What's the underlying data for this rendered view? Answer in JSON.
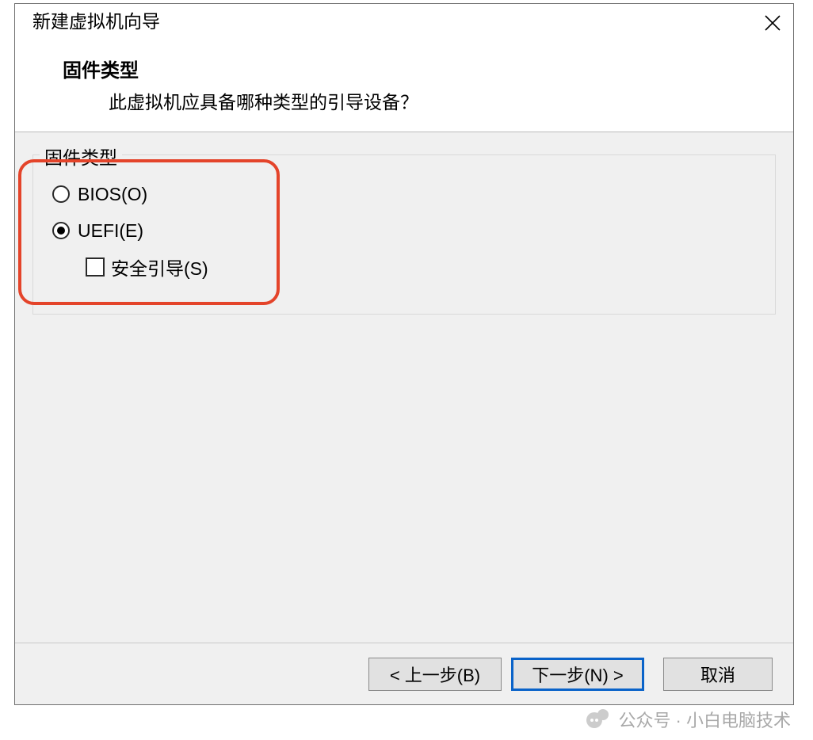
{
  "dialog": {
    "title": "新建虚拟机向导",
    "close_icon": "close"
  },
  "header": {
    "title": "固件类型",
    "subtitle": "此虚拟机应具备哪种类型的引导设备？"
  },
  "group": {
    "legend": "固件类型",
    "options": {
      "bios": {
        "label": "BIOS(O)",
        "selected": false
      },
      "uefi": {
        "label": "UEFI(E)",
        "selected": true
      },
      "secure_boot": {
        "label": "安全引导(S)",
        "checked": false
      }
    }
  },
  "footer": {
    "back": "< 上一步(B)",
    "next": "下一步(N) >",
    "cancel": "取消"
  },
  "watermark": {
    "text": "公众号 · 小白电脑技术"
  },
  "annotation": {
    "highlight_color": "#e4442a"
  }
}
